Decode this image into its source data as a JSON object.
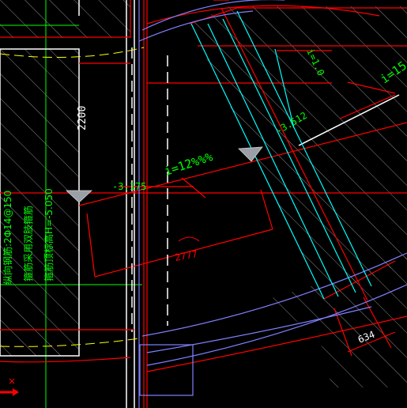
{
  "drawing": {
    "dimension_vertical": "2200",
    "slope_main": "i=12%%%",
    "slope_right": "i=15",
    "slope_upper": "i=1.0",
    "elevation_left": "-3.175",
    "elevation_right": "-3.512",
    "arc_length": "2777",
    "dimension_bottom_right": "634",
    "note_line1": "纵向钢筋:2Φ14@150",
    "note_line2": "箍筋采用双肢箍筋",
    "note_line3": "箍筋顶标高H=-5.050"
  },
  "colors": {
    "background": "#000000",
    "red": "#ff0000",
    "cyan": "#00ffff",
    "green": "#00ff00",
    "yellow": "#ffff00",
    "white": "#ffffff",
    "blue": "#8080ff",
    "hatch": "#9a9a9a",
    "marker": "#9aa0a6"
  }
}
